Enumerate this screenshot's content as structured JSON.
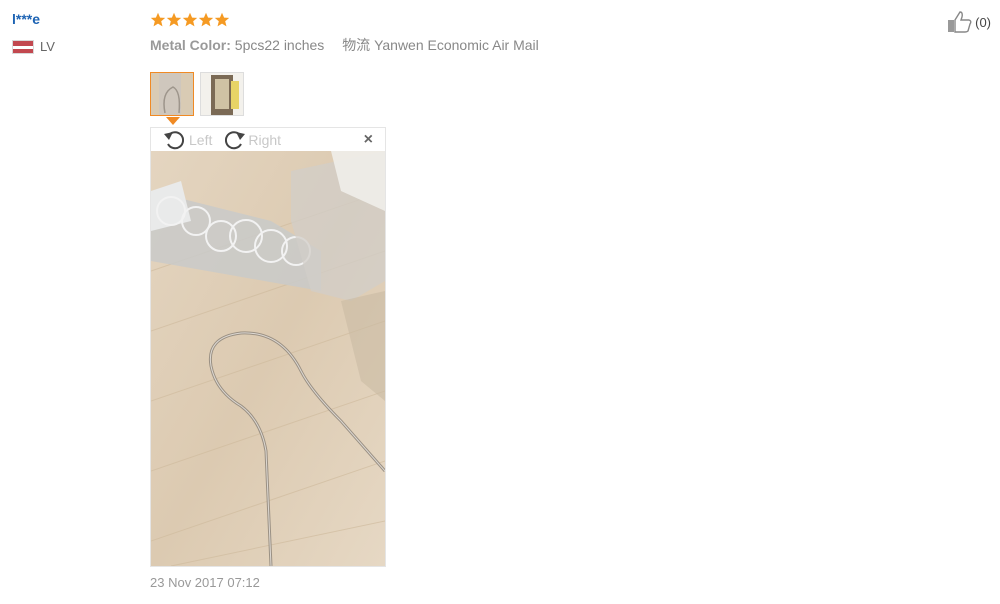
{
  "reviewer": {
    "name": "l***e",
    "country_code": "LV"
  },
  "rating": {
    "stars": 5,
    "max": 5
  },
  "review": {
    "attr_key": "Metal Color:",
    "attr_value": "5pcs22 inches",
    "shipping": "物流 Yanwen Economic Air Mail"
  },
  "viewer": {
    "rotate_left": "Left",
    "rotate_right": "Right",
    "close": "×"
  },
  "date": "23 Nov 2017 07:12",
  "helpful": {
    "count": "(0)"
  },
  "colors": {
    "link": "#1d63b3",
    "star": "#f59a23",
    "active_thumb": "#f08a24"
  },
  "icons": [
    "flag-latvia-icon",
    "star-icon",
    "rotate-left-icon",
    "rotate-right-icon",
    "close-icon",
    "thumbs-up-icon"
  ]
}
